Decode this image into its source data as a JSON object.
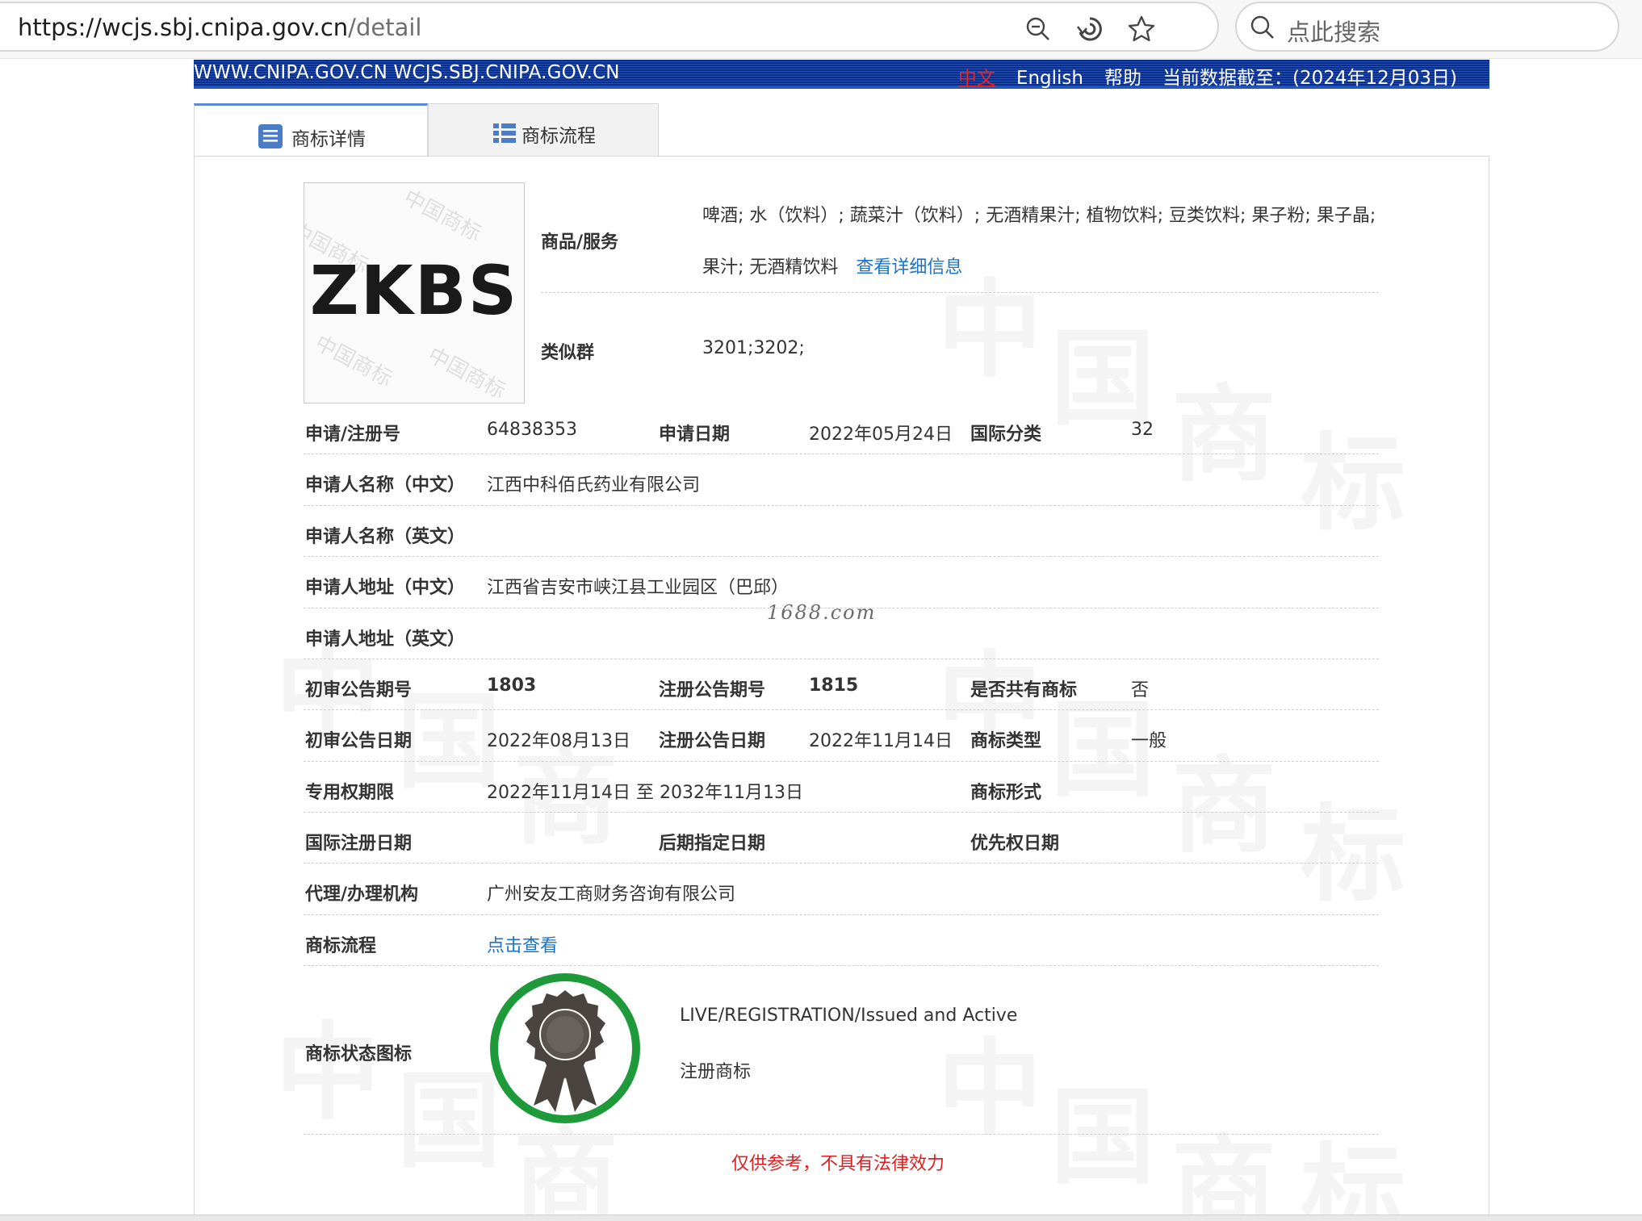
{
  "browser": {
    "url_host": "https://wcjs.sbj.cnipa.gov.cn",
    "url_path": "/detail",
    "search_placeholder": "点此搜索"
  },
  "banner": {
    "site": "WWW.CNIPA.GOV.CN WCJS.SBJ.CNIPA.GOV.CN",
    "lang_cn": "中文",
    "lang_en": "English",
    "help": "帮助",
    "data_date": "当前数据截至：(2024年12月03日)"
  },
  "tabs": {
    "detail": "商标详情",
    "flow": "商标流程"
  },
  "trademark": {
    "logo_text": "ZKBS",
    "logo_watermark": "中国商标",
    "goods_label": "商品/服务",
    "goods_line1": "啤酒; 水（饮料）; 蔬菜汁（饮料）; 无酒精果汁; 植物饮料; 豆类饮料; 果子粉; 果子晶;",
    "goods_line2": "果汁; 无酒精饮料",
    "goods_more": "查看详细信息",
    "similar_label": "类似群",
    "similar_value": "3201;3202;"
  },
  "fields": {
    "reg_no_label": "申请/注册号",
    "reg_no": "64838353",
    "apply_date_label": "申请日期",
    "apply_date": "2022年05月24日",
    "intl_class_label": "国际分类",
    "intl_class": "32",
    "applicant_cn_label": "申请人名称（中文）",
    "applicant_cn": "江西中科佰氏药业有限公司",
    "applicant_en_label": "申请人名称（英文）",
    "address_cn_label": "申请人地址（中文）",
    "address_cn": "江西省吉安市峡江县工业园区（巴邱）",
    "address_en_label": "申请人地址（英文）",
    "prelim_no_label": "初审公告期号",
    "prelim_no": "1803",
    "reg_pub_no_label": "注册公告期号",
    "reg_pub_no": "1815",
    "shared_label": "是否共有商标",
    "shared": "否",
    "prelim_date_label": "初审公告日期",
    "prelim_date": "2022年08月13日",
    "reg_pub_date_label": "注册公告日期",
    "reg_pub_date": "2022年11月14日",
    "tm_type_label": "商标类型",
    "tm_type": "一般",
    "exclusive_label": "专用权期限",
    "exclusive": "2022年11月14日 至 2032年11月13日",
    "tm_form_label": "商标形式",
    "intl_reg_date_label": "国际注册日期",
    "later_date_label": "后期指定日期",
    "priority_date_label": "优先权日期",
    "agent_label": "代理/办理机构",
    "agent": "广州安友工商财务咨询有限公司",
    "flow_label": "商标流程",
    "flow_link": "点击查看",
    "status_icon_label": "商标状态图标",
    "status_en": "LIVE/REGISTRATION/Issued and Active",
    "status_cn": "注册商标"
  },
  "page_watermark": "1688.com",
  "background_watermark_chars": [
    "中",
    "国",
    "商",
    "标"
  ],
  "disclaimer": "仅供参考，不具有法律效力",
  "colors": {
    "banner": "#0a2f8a",
    "link": "#1a73c8",
    "disclaimer": "#e02020",
    "status_ring": "#1e9a3a"
  }
}
